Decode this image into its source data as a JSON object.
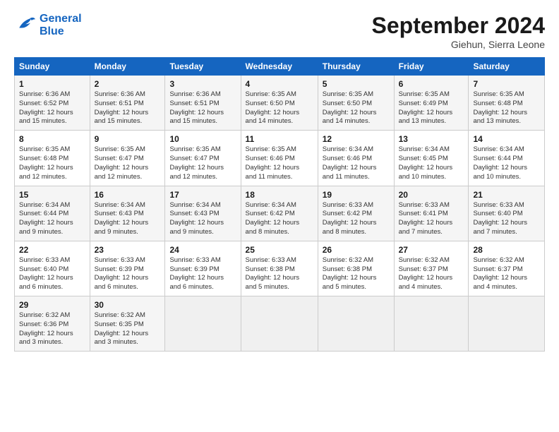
{
  "header": {
    "logo_line1": "General",
    "logo_line2": "Blue",
    "month": "September 2024",
    "location": "Giehun, Sierra Leone"
  },
  "weekdays": [
    "Sunday",
    "Monday",
    "Tuesday",
    "Wednesday",
    "Thursday",
    "Friday",
    "Saturday"
  ],
  "weeks": [
    [
      {
        "day": "1",
        "sunrise": "6:36 AM",
        "sunset": "6:52 PM",
        "daylight": "12 hours and 15 minutes."
      },
      {
        "day": "2",
        "sunrise": "6:36 AM",
        "sunset": "6:51 PM",
        "daylight": "12 hours and 15 minutes."
      },
      {
        "day": "3",
        "sunrise": "6:36 AM",
        "sunset": "6:51 PM",
        "daylight": "12 hours and 15 minutes."
      },
      {
        "day": "4",
        "sunrise": "6:35 AM",
        "sunset": "6:50 PM",
        "daylight": "12 hours and 14 minutes."
      },
      {
        "day": "5",
        "sunrise": "6:35 AM",
        "sunset": "6:50 PM",
        "daylight": "12 hours and 14 minutes."
      },
      {
        "day": "6",
        "sunrise": "6:35 AM",
        "sunset": "6:49 PM",
        "daylight": "12 hours and 13 minutes."
      },
      {
        "day": "7",
        "sunrise": "6:35 AM",
        "sunset": "6:48 PM",
        "daylight": "12 hours and 13 minutes."
      }
    ],
    [
      {
        "day": "8",
        "sunrise": "6:35 AM",
        "sunset": "6:48 PM",
        "daylight": "12 hours and 12 minutes."
      },
      {
        "day": "9",
        "sunrise": "6:35 AM",
        "sunset": "6:47 PM",
        "daylight": "12 hours and 12 minutes."
      },
      {
        "day": "10",
        "sunrise": "6:35 AM",
        "sunset": "6:47 PM",
        "daylight": "12 hours and 12 minutes."
      },
      {
        "day": "11",
        "sunrise": "6:35 AM",
        "sunset": "6:46 PM",
        "daylight": "12 hours and 11 minutes."
      },
      {
        "day": "12",
        "sunrise": "6:34 AM",
        "sunset": "6:46 PM",
        "daylight": "12 hours and 11 minutes."
      },
      {
        "day": "13",
        "sunrise": "6:34 AM",
        "sunset": "6:45 PM",
        "daylight": "12 hours and 10 minutes."
      },
      {
        "day": "14",
        "sunrise": "6:34 AM",
        "sunset": "6:44 PM",
        "daylight": "12 hours and 10 minutes."
      }
    ],
    [
      {
        "day": "15",
        "sunrise": "6:34 AM",
        "sunset": "6:44 PM",
        "daylight": "12 hours and 9 minutes."
      },
      {
        "day": "16",
        "sunrise": "6:34 AM",
        "sunset": "6:43 PM",
        "daylight": "12 hours and 9 minutes."
      },
      {
        "day": "17",
        "sunrise": "6:34 AM",
        "sunset": "6:43 PM",
        "daylight": "12 hours and 9 minutes."
      },
      {
        "day": "18",
        "sunrise": "6:34 AM",
        "sunset": "6:42 PM",
        "daylight": "12 hours and 8 minutes."
      },
      {
        "day": "19",
        "sunrise": "6:33 AM",
        "sunset": "6:42 PM",
        "daylight": "12 hours and 8 minutes."
      },
      {
        "day": "20",
        "sunrise": "6:33 AM",
        "sunset": "6:41 PM",
        "daylight": "12 hours and 7 minutes."
      },
      {
        "day": "21",
        "sunrise": "6:33 AM",
        "sunset": "6:40 PM",
        "daylight": "12 hours and 7 minutes."
      }
    ],
    [
      {
        "day": "22",
        "sunrise": "6:33 AM",
        "sunset": "6:40 PM",
        "daylight": "12 hours and 6 minutes."
      },
      {
        "day": "23",
        "sunrise": "6:33 AM",
        "sunset": "6:39 PM",
        "daylight": "12 hours and 6 minutes."
      },
      {
        "day": "24",
        "sunrise": "6:33 AM",
        "sunset": "6:39 PM",
        "daylight": "12 hours and 6 minutes."
      },
      {
        "day": "25",
        "sunrise": "6:33 AM",
        "sunset": "6:38 PM",
        "daylight": "12 hours and 5 minutes."
      },
      {
        "day": "26",
        "sunrise": "6:32 AM",
        "sunset": "6:38 PM",
        "daylight": "12 hours and 5 minutes."
      },
      {
        "day": "27",
        "sunrise": "6:32 AM",
        "sunset": "6:37 PM",
        "daylight": "12 hours and 4 minutes."
      },
      {
        "day": "28",
        "sunrise": "6:32 AM",
        "sunset": "6:37 PM",
        "daylight": "12 hours and 4 minutes."
      }
    ],
    [
      {
        "day": "29",
        "sunrise": "6:32 AM",
        "sunset": "6:36 PM",
        "daylight": "12 hours and 3 minutes."
      },
      {
        "day": "30",
        "sunrise": "6:32 AM",
        "sunset": "6:35 PM",
        "daylight": "12 hours and 3 minutes."
      },
      null,
      null,
      null,
      null,
      null
    ]
  ],
  "labels": {
    "sunrise": "Sunrise:",
    "sunset": "Sunset:",
    "daylight": "Daylight:"
  }
}
